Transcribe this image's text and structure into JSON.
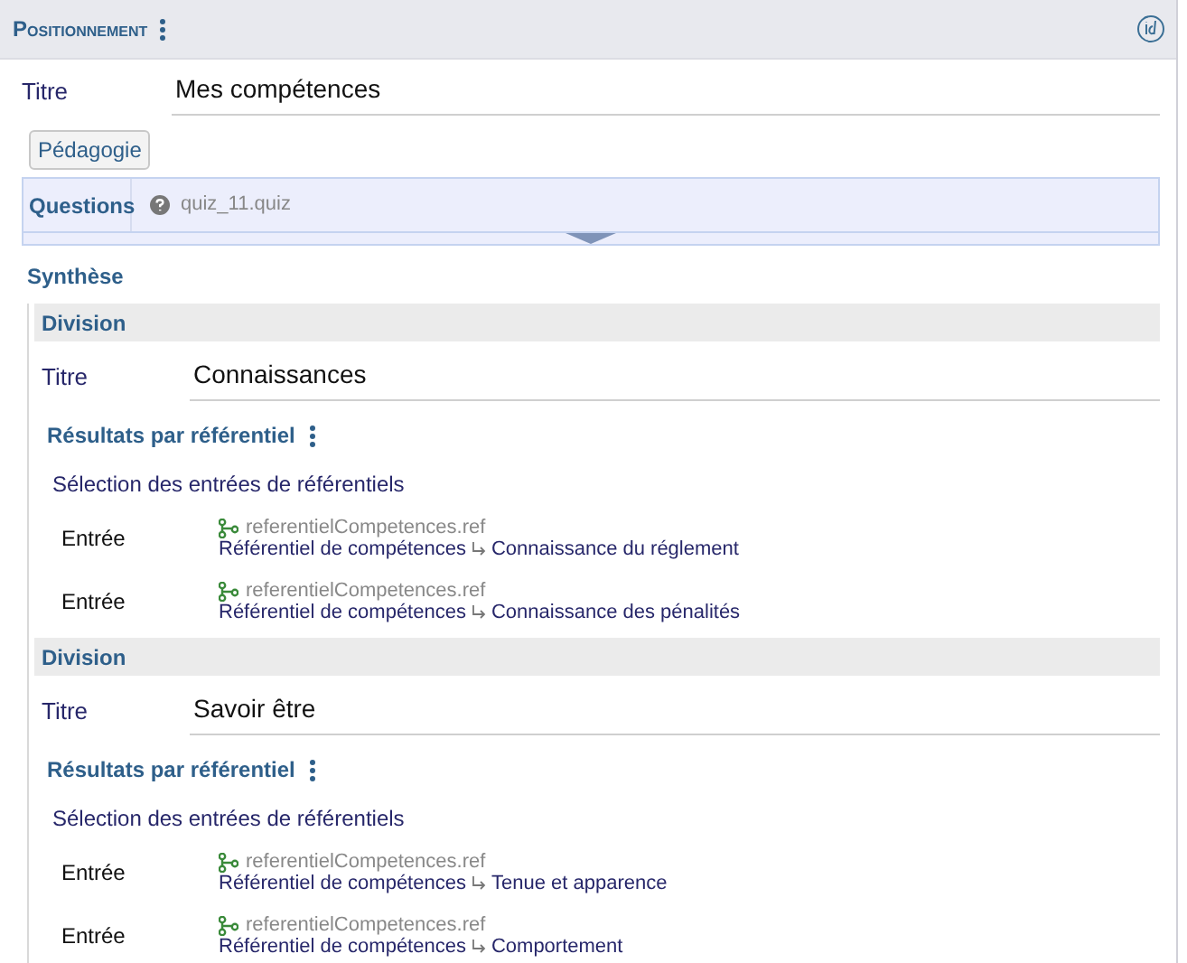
{
  "header": {
    "title": "Positionnement"
  },
  "title_field": {
    "label": "Titre",
    "value": "Mes compétences"
  },
  "tab_button": "Pédagogie",
  "questions": {
    "label": "Questions",
    "file": "quiz_11.quiz"
  },
  "synthese": "Synthèse",
  "divisions": [
    {
      "heading": "Division",
      "title_label": "Titre",
      "title_value": "Connaissances",
      "results_heading": "Résultats par référentiel",
      "selection_label": "Sélection des entrées de référentiels",
      "entries": [
        {
          "label": "Entrée",
          "file": "referentielCompetences.ref",
          "path": "Référentiel de compétences",
          "item": "Connaissance du réglement"
        },
        {
          "label": "Entrée",
          "file": "referentielCompetences.ref",
          "path": "Référentiel de compétences",
          "item": "Connaissance des pénalités"
        }
      ]
    },
    {
      "heading": "Division",
      "title_label": "Titre",
      "title_value": "Savoir être",
      "results_heading": "Résultats par référentiel",
      "selection_label": "Sélection des entrées de référentiels",
      "entries": [
        {
          "label": "Entrée",
          "file": "referentielCompetences.ref",
          "path": "Référentiel de compétences",
          "item": "Tenue et apparence"
        },
        {
          "label": "Entrée",
          "file": "referentielCompetences.ref",
          "path": "Référentiel de compétences",
          "item": "Comportement"
        }
      ]
    }
  ]
}
